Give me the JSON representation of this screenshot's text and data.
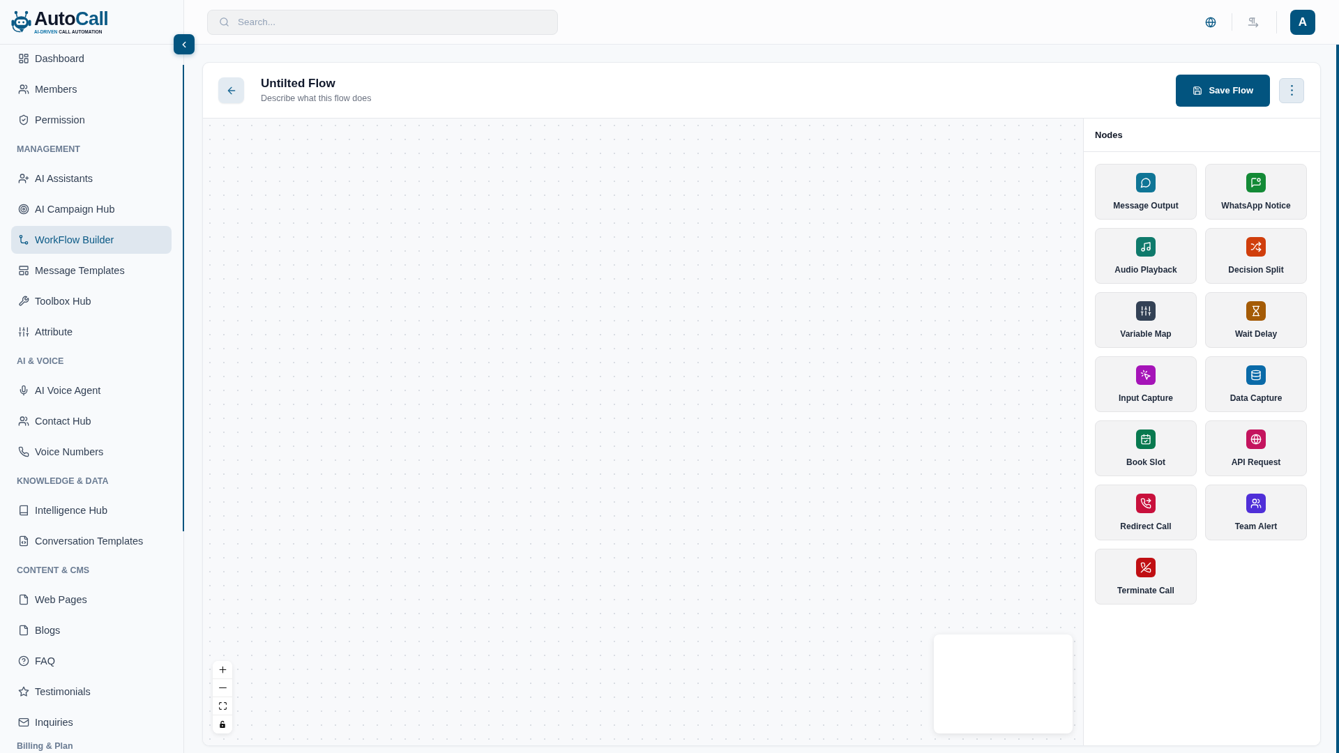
{
  "sidebar": {
    "logo": {
      "wordmark_parts": [
        "Auto",
        "Call"
      ],
      "tagline_parts": [
        "AI-DRIVEN",
        "CALL AUTOMATION"
      ]
    },
    "sections": [
      {
        "items": [
          {
            "label": "Dashboard",
            "selected": false
          },
          {
            "label": "Members",
            "selected": false
          },
          {
            "label": "Permission",
            "selected": false
          }
        ]
      },
      {
        "heading": "MANAGEMENT",
        "items": [
          {
            "label": "AI Assistants",
            "selected": false
          },
          {
            "label": "AI Campaign Hub",
            "selected": false
          },
          {
            "label": "WorkFlow Builder",
            "selected": true
          },
          {
            "label": "Message Templates",
            "selected": false
          },
          {
            "label": "Toolbox Hub",
            "selected": false
          },
          {
            "label": "Attribute",
            "selected": false
          }
        ]
      },
      {
        "heading": "AI & VOICE",
        "items": [
          {
            "label": "AI Voice Agent",
            "selected": false
          },
          {
            "label": "Contact Hub",
            "selected": false
          },
          {
            "label": "Voice Numbers",
            "selected": false
          }
        ]
      },
      {
        "heading": "KNOWLEDGE & DATA",
        "items": [
          {
            "label": "Intelligence Hub",
            "selected": false
          },
          {
            "label": "Conversation Templates",
            "selected": false
          }
        ]
      },
      {
        "heading": "CONTENT & CMS",
        "items": [
          {
            "label": "Web Pages",
            "selected": false
          },
          {
            "label": "Blogs",
            "selected": false
          },
          {
            "label": "FAQ",
            "selected": false
          },
          {
            "label": "Testimonials",
            "selected": false
          },
          {
            "label": "Inquiries",
            "selected": false
          }
        ]
      },
      {
        "heading": "Billing & Plan"
      }
    ]
  },
  "topbar": {
    "search": {
      "placeholder": "Search..."
    },
    "avatar": {
      "initial": "A"
    }
  },
  "flow": {
    "title": "Untilted Flow",
    "description": "Describe what this flow does",
    "save_button": "Save Flow"
  },
  "nodes_panel": {
    "title": "Nodes",
    "nodes": [
      {
        "label": "Message Output",
        "color": "#0f7596"
      },
      {
        "label": "WhatsApp Notice",
        "color": "#138a36"
      },
      {
        "label": "Audio Playback",
        "color": "#0f7a6c"
      },
      {
        "label": "Decision Split",
        "color": "#d03e0c"
      },
      {
        "label": "Variable Map",
        "color": "#334155"
      },
      {
        "label": "Wait Delay",
        "color": "#a45b06"
      },
      {
        "label": "Input Capture",
        "color": "#a514b8"
      },
      {
        "label": "Data Capture",
        "color": "#0a6aa8"
      },
      {
        "label": "Book Slot",
        "color": "#08794f"
      },
      {
        "label": "API Request",
        "color": "#c4145e"
      },
      {
        "label": "Redirect Call",
        "color": "#c8103c"
      },
      {
        "label": "Team Alert",
        "color": "#4f2fd8"
      },
      {
        "label": "Terminate Call",
        "color": "#c00f13"
      }
    ]
  }
}
